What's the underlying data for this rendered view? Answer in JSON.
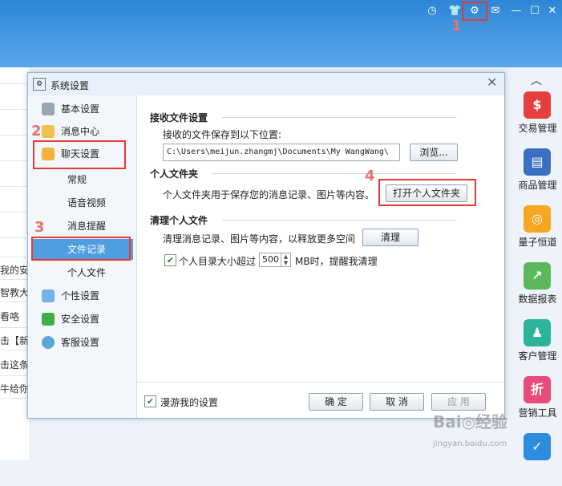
{
  "window": {
    "title": "系统设置",
    "close_glyph": "✕"
  },
  "steps": {
    "s1": "1",
    "s2": "2",
    "s3": "3",
    "s4": "4"
  },
  "top_icons": [
    "clock-icon",
    "tshirt-icon",
    "gear-icon",
    "mail-icon",
    "minimize-icon",
    "maximize-icon",
    "close-icon"
  ],
  "background_left": {
    "lines": [
      "我的安",
      "智教大叶",
      "看咯",
      "击【新",
      "击这条",
      "牛给你"
    ]
  },
  "nav": {
    "items": [
      {
        "label": "基本设置"
      },
      {
        "label": "消息中心"
      },
      {
        "label": "聊天设置"
      },
      {
        "label": "个性设置"
      },
      {
        "label": "安全设置"
      },
      {
        "label": "客服设置"
      }
    ],
    "sub_items": [
      {
        "label": "常规"
      },
      {
        "label": "语音视频"
      },
      {
        "label": "消息提醒"
      },
      {
        "label": "文件记录"
      },
      {
        "label": "个人文件"
      }
    ]
  },
  "content": {
    "recv_section": "接收文件设置",
    "recv_text": "接收的文件保存到以下位置:",
    "recv_path": "C:\\Users\\meijun.zhangmj\\Documents\\My WangWang\\",
    "browse_button": "浏览...",
    "personal_section": "个人文件夹",
    "personal_text": "个人文件夹用于保存您的消息记录、图片等内容。",
    "open_folder_button": "打开个人文件夹",
    "clean_section": "清理个人文件",
    "clean_text": "清理消息记录、图片等内容，以释放更多空间",
    "clean_button": "清理",
    "limit_prefix": "个人目录大小超过",
    "limit_value": "500",
    "limit_suffix": "MB时，提醒我清理",
    "limit_checked": true
  },
  "footer": {
    "roam_label": "漫游我的设置",
    "roam_checked": true,
    "ok_button": "确 定",
    "cancel_button": "取 消",
    "apply_button": "应 用"
  },
  "sidebar": {
    "up_glyph": "︿",
    "items": [
      {
        "label": "交易管理",
        "glyph": "$",
        "color": "#e53e3e"
      },
      {
        "label": "商品管理",
        "glyph": "▤",
        "color": "#3b6fc4"
      },
      {
        "label": "量子恒道",
        "glyph": "◎",
        "color": "#f5a623"
      },
      {
        "label": "数据报表",
        "glyph": "↗",
        "color": "#5cb85c"
      },
      {
        "label": "客户管理",
        "glyph": "♟",
        "color": "#2bb39b"
      },
      {
        "label": "营销工具",
        "glyph": "折",
        "color": "#e94b7a"
      }
    ]
  },
  "watermark": {
    "brand": "Bai◎经验",
    "url": "jingyan.baidu.com"
  },
  "colors": {
    "accent": "#4f9fe0",
    "highlight": "#e53935"
  }
}
